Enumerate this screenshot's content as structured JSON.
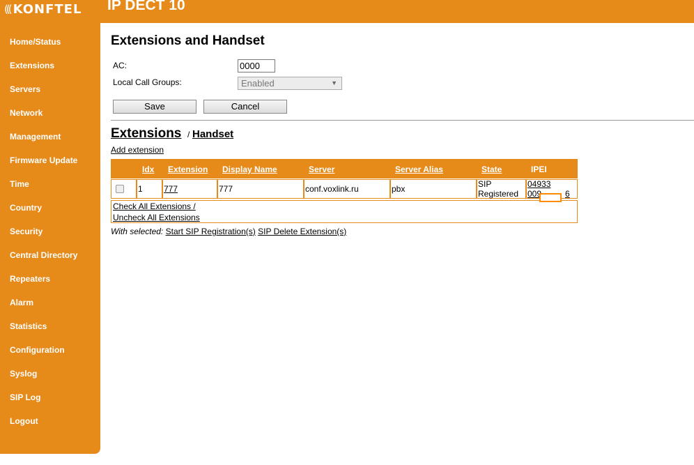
{
  "brand": {
    "logo_text": "KONFTEL",
    "product": "IP DECT 10"
  },
  "sidebar": {
    "items": [
      {
        "label": "Home/Status"
      },
      {
        "label": "Extensions"
      },
      {
        "label": "Servers"
      },
      {
        "label": "Network"
      },
      {
        "label": "Management"
      },
      {
        "label": "Firmware Update"
      },
      {
        "label": "Time"
      },
      {
        "label": "Country"
      },
      {
        "label": "Security"
      },
      {
        "label": "Central Directory"
      },
      {
        "label": "Repeaters"
      },
      {
        "label": "Alarm"
      },
      {
        "label": "Statistics"
      },
      {
        "label": "Configuration"
      },
      {
        "label": "Syslog"
      },
      {
        "label": "SIP Log"
      },
      {
        "label": "Logout"
      }
    ]
  },
  "page": {
    "title": "Extensions and Handset",
    "ac_label": "AC:",
    "ac_value": "0000",
    "lcg_label": "Local Call Groups:",
    "lcg_value": "Enabled",
    "save_label": "Save",
    "cancel_label": "Cancel"
  },
  "extensions": {
    "title": "Extensions",
    "separator": "/",
    "handset_link": "Handset",
    "add_link": "Add extension",
    "columns": [
      "Idx",
      "Extension",
      "Display Name",
      "Server",
      "Server Alias",
      "State",
      "IPEI"
    ],
    "rows": [
      {
        "idx": "1",
        "extension": "777",
        "display_name": "777",
        "server": "conf.voxlink.ru",
        "server_alias": "pbx",
        "state_line1": "SIP",
        "state_line2": "Registered",
        "ipei_line1": "04933",
        "ipei_line2_start": "009",
        "ipei_line2_end": "6"
      }
    ],
    "check_all": "Check All Extensions /",
    "uncheck_all": "Uncheck All Extensions",
    "with_selected": "With selected:",
    "start_sip": "Start SIP Registration(s)",
    "sip_delete": "SIP Delete Extension(s)"
  },
  "colors": {
    "accent": "#e68a1a"
  }
}
